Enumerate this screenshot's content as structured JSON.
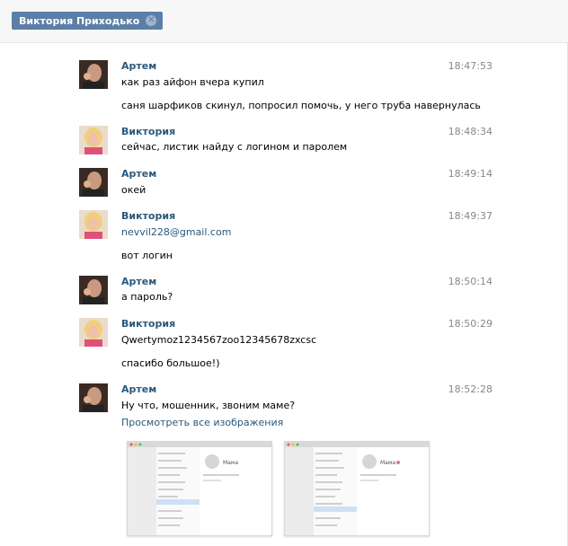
{
  "header": {
    "tab_title": "Виктория Приходько"
  },
  "messages": [
    {
      "sender": "Артем",
      "time": "18:47:53",
      "avatar": "artem",
      "lines": [
        "как раз айфон вчера купил",
        "саня шарфиков скинул, попросил помочь, у него труба навернулась"
      ]
    },
    {
      "sender": "Виктория",
      "time": "18:48:34",
      "avatar": "viktoria",
      "lines": [
        "сейчас, листик найду с логином и паролем"
      ]
    },
    {
      "sender": "Артем",
      "time": "18:49:14",
      "avatar": "artem",
      "lines": [
        "окей"
      ]
    },
    {
      "sender": "Виктория",
      "time": "18:49:37",
      "avatar": "viktoria",
      "lines": [
        "nevvil228@gmail.com",
        "вот логин"
      ]
    },
    {
      "sender": "Артем",
      "time": "18:50:14",
      "avatar": "artem",
      "lines": [
        "а пароль?"
      ]
    },
    {
      "sender": "Виктория",
      "time": "18:50:29",
      "avatar": "viktoria",
      "lines": [
        "Qwertymoz1234567zoo12345678zxcsc",
        "спасибо большое!)"
      ]
    },
    {
      "sender": "Артем",
      "time": "18:52:28",
      "avatar": "artem",
      "lines": [
        "Ну что, мошенник, звоним маме?"
      ],
      "link": "Просмотреть все изображения"
    }
  ],
  "attachments": [
    {
      "contact_name": "Мама"
    },
    {
      "contact_name": "Мама"
    }
  ],
  "colors": {
    "name": "#2b587a",
    "tab": "#5b7fa6",
    "time": "#888888"
  }
}
